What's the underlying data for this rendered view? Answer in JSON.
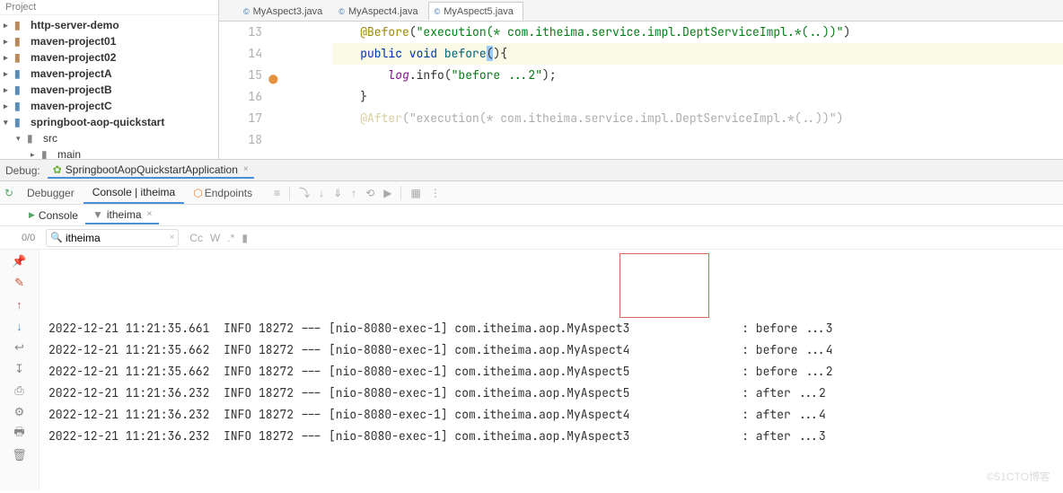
{
  "project": {
    "header": "Project",
    "items": [
      {
        "label": "http-server-demo",
        "bold": true,
        "indent": 0,
        "arrow": ">",
        "iconColor": ""
      },
      {
        "label": "maven-project01",
        "bold": true,
        "indent": 0,
        "arrow": ">",
        "iconColor": ""
      },
      {
        "label": "maven-project02",
        "bold": true,
        "indent": 0,
        "arrow": ">",
        "iconColor": ""
      },
      {
        "label": "maven-projectA",
        "bold": true,
        "indent": 0,
        "arrow": ">",
        "iconColor": "blue"
      },
      {
        "label": "maven-projectB",
        "bold": true,
        "indent": 0,
        "arrow": ">",
        "iconColor": "blue"
      },
      {
        "label": "maven-projectC",
        "bold": true,
        "indent": 0,
        "arrow": ">",
        "iconColor": "blue"
      },
      {
        "label": "springboot-aop-quickstart",
        "bold": true,
        "indent": 0,
        "arrow": "v",
        "iconColor": "blue"
      },
      {
        "label": "src",
        "bold": false,
        "indent": 1,
        "arrow": "v",
        "iconColor": "grey"
      },
      {
        "label": "main",
        "bold": false,
        "indent": 2,
        "arrow": ">",
        "iconColor": "grey"
      }
    ]
  },
  "editor": {
    "tabs": [
      {
        "label": "MyAspect3.java",
        "active": false
      },
      {
        "label": "MyAspect4.java",
        "active": false
      },
      {
        "label": "MyAspect5.java",
        "active": true
      }
    ],
    "lines": [
      {
        "num": "13",
        "html": ""
      },
      {
        "num": "14",
        "parts": [
          "    ",
          {
            "t": "@Before",
            "c": "kw-anno"
          },
          "(",
          {
            "t": "\"execution(* com.itheima.service.impl.DeptServiceImpl.*(..))\"",
            "c": "str"
          },
          ")"
        ]
      },
      {
        "num": "15",
        "hl": true,
        "gutterIcon": "m",
        "parts": [
          "    ",
          {
            "t": "public void ",
            "c": "kw"
          },
          {
            "t": "before",
            "c": "method"
          },
          {
            "t": "(",
            "c": "paren-hl"
          },
          {
            "t": ")",
            "c": ""
          },
          "{"
        ]
      },
      {
        "num": "16",
        "parts": [
          "        ",
          {
            "t": "log",
            "c": "ident"
          },
          ".info(",
          {
            "t": "\"before ...2\"",
            "c": "str"
          },
          ");"
        ]
      },
      {
        "num": "17",
        "parts": [
          "    }"
        ]
      },
      {
        "num": "18",
        "parts": [
          ""
        ]
      },
      {
        "num": "",
        "parts": [
          "    ",
          {
            "t": "@After",
            "c": "kw-anno faded"
          },
          {
            "t": "(\"",
            "c": "faded"
          },
          {
            "t": "execution",
            "c": "faded"
          },
          {
            "t": "(* com.itheima.service.impl.DeptServiceImpl.*(..))\")",
            "c": "faded"
          }
        ],
        "faded": true
      }
    ]
  },
  "debug": {
    "label": "Debug:",
    "config": "SpringbootAopQuickstartApplication"
  },
  "toolbar": {
    "debugger": "Debugger",
    "console": "Console | itheima",
    "endpoints": "Endpoints"
  },
  "subtabs": {
    "console": "Console",
    "filter": "itheima"
  },
  "filterRow": {
    "count": "0/0",
    "searchValue": "itheima"
  },
  "logs": [
    "2022-12-21 11:21:35.661  INFO 18272 --- [nio-8080-exec-1] com.itheima.aop.MyAspect3                : before ...3",
    "2022-12-21 11:21:35.662  INFO 18272 --- [nio-8080-exec-1] com.itheima.aop.MyAspect4                : before ...4",
    "2022-12-21 11:21:35.662  INFO 18272 --- [nio-8080-exec-1] com.itheima.aop.MyAspect5                : before ...2",
    "2022-12-21 11:21:36.232  INFO 18272 --- [nio-8080-exec-1] com.itheima.aop.MyAspect5                : after ...2",
    "2022-12-21 11:21:36.232  INFO 18272 --- [nio-8080-exec-1] com.itheima.aop.MyAspect4                : after ...4",
    "2022-12-21 11:21:36.232  INFO 18272 --- [nio-8080-exec-1] com.itheima.aop.MyAspect3                : after ...3"
  ],
  "watermark": "©51CTO博客"
}
